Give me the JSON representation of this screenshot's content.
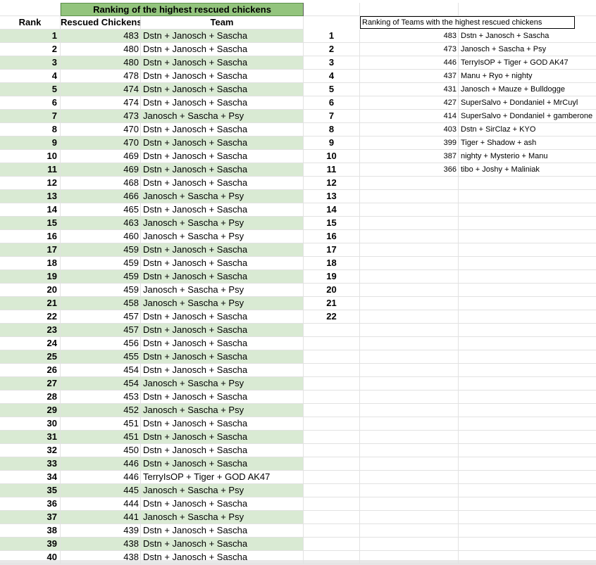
{
  "left_table": {
    "title": "Ranking of the highest rescued chickens",
    "headers": [
      "Rank",
      "Rescued Chickens",
      "Team"
    ],
    "rows": [
      {
        "rank": "1",
        "chickens": "483",
        "team": "Dstn + Janosch + Sascha",
        "green": true
      },
      {
        "rank": "2",
        "chickens": "480",
        "team": "Dstn + Janosch + Sascha",
        "green": false
      },
      {
        "rank": "3",
        "chickens": "480",
        "team": "Dstn + Janosch + Sascha",
        "green": true
      },
      {
        "rank": "4",
        "chickens": "478",
        "team": "Dstn + Janosch + Sascha",
        "green": false
      },
      {
        "rank": "5",
        "chickens": "474",
        "team": "Dstn + Janosch + Sascha",
        "green": true
      },
      {
        "rank": "6",
        "chickens": "474",
        "team": "Dstn + Janosch + Sascha",
        "green": false
      },
      {
        "rank": "7",
        "chickens": "473",
        "team": "Janosch + Sascha + Psy",
        "green": true
      },
      {
        "rank": "8",
        "chickens": "470",
        "team": "Dstn + Janosch + Sascha",
        "green": false
      },
      {
        "rank": "9",
        "chickens": "470",
        "team": "Dstn + Janosch + Sascha",
        "green": true
      },
      {
        "rank": "10",
        "chickens": "469",
        "team": "Dstn + Janosch + Sascha",
        "green": false
      },
      {
        "rank": "11",
        "chickens": "469",
        "team": "Dstn + Janosch + Sascha",
        "green": true
      },
      {
        "rank": "12",
        "chickens": "468",
        "team": "Dstn + Janosch + Sascha",
        "green": false
      },
      {
        "rank": "13",
        "chickens": "466",
        "team": "Janosch + Sascha + Psy",
        "green": true
      },
      {
        "rank": "14",
        "chickens": "465",
        "team": "Dstn + Janosch + Sascha",
        "green": false
      },
      {
        "rank": "15",
        "chickens": "463",
        "team": "Janosch + Sascha + Psy",
        "green": true
      },
      {
        "rank": "16",
        "chickens": "460",
        "team": "Janosch + Sascha + Psy",
        "green": false
      },
      {
        "rank": "17",
        "chickens": "459",
        "team": "Dstn + Janosch + Sascha",
        "green": true
      },
      {
        "rank": "18",
        "chickens": "459",
        "team": "Dstn + Janosch + Sascha",
        "green": false
      },
      {
        "rank": "19",
        "chickens": "459",
        "team": "Dstn + Janosch + Sascha",
        "green": true
      },
      {
        "rank": "20",
        "chickens": "459",
        "team": "Janosch + Sascha + Psy",
        "green": false
      },
      {
        "rank": "21",
        "chickens": "458",
        "team": "Janosch + Sascha + Psy",
        "green": true
      },
      {
        "rank": "22",
        "chickens": "457",
        "team": "Dstn + Janosch + Sascha",
        "green": false
      },
      {
        "rank": "23",
        "chickens": "457",
        "team": "Dstn + Janosch + Sascha",
        "green": true
      },
      {
        "rank": "24",
        "chickens": "456",
        "team": "Dstn + Janosch + Sascha",
        "green": false
      },
      {
        "rank": "25",
        "chickens": "455",
        "team": "Dstn + Janosch + Sascha",
        "green": true
      },
      {
        "rank": "26",
        "chickens": "454",
        "team": "Dstn + Janosch + Sascha",
        "green": false
      },
      {
        "rank": "27",
        "chickens": "454",
        "team": "Janosch + Sascha + Psy",
        "green": true
      },
      {
        "rank": "28",
        "chickens": "453",
        "team": "Dstn + Janosch + Sascha",
        "green": false
      },
      {
        "rank": "29",
        "chickens": "452",
        "team": "Janosch + Sascha + Psy",
        "green": true
      },
      {
        "rank": "30",
        "chickens": "451",
        "team": "Dstn + Janosch + Sascha",
        "green": false
      },
      {
        "rank": "31",
        "chickens": "451",
        "team": "Dstn + Janosch + Sascha",
        "green": true
      },
      {
        "rank": "32",
        "chickens": "450",
        "team": "Dstn + Janosch + Sascha",
        "green": false
      },
      {
        "rank": "33",
        "chickens": "446",
        "team": "Dstn + Janosch + Sascha",
        "green": true
      },
      {
        "rank": "34",
        "chickens": "446",
        "team": "TerryIsOP + Tiger + GOD AK47",
        "green": false
      },
      {
        "rank": "35",
        "chickens": "445",
        "team": "Janosch + Sascha + Psy",
        "green": true
      },
      {
        "rank": "36",
        "chickens": "444",
        "team": "Dstn + Janosch + Sascha",
        "green": false
      },
      {
        "rank": "37",
        "chickens": "441",
        "team": "Janosch + Sascha + Psy",
        "green": true
      },
      {
        "rank": "38",
        "chickens": "439",
        "team": "Dstn + Janosch + Sascha",
        "green": false
      },
      {
        "rank": "39",
        "chickens": "438",
        "team": "Dstn + Janosch + Sascha",
        "green": true
      },
      {
        "rank": "40",
        "chickens": "438",
        "team": "Dstn + Janosch + Sascha",
        "green": false
      }
    ]
  },
  "right_table": {
    "title": "Ranking of Teams with the highest rescued chickens",
    "rows": [
      {
        "rank": "1",
        "chickens": "483",
        "team": "Dstn + Janosch + Sascha"
      },
      {
        "rank": "2",
        "chickens": "473",
        "team": "Janosch + Sascha + Psy"
      },
      {
        "rank": "3",
        "chickens": "446",
        "team": "TerryIsOP + Tiger + GOD AK47"
      },
      {
        "rank": "4",
        "chickens": "437",
        "team": "Manu + Ryo + nighty"
      },
      {
        "rank": "5",
        "chickens": "431",
        "team": "Janosch + Mauze + Bulldogge"
      },
      {
        "rank": "6",
        "chickens": "427",
        "team": "SuperSalvo + Dondaniel + MrCuyl"
      },
      {
        "rank": "7",
        "chickens": "414",
        "team": "SuperSalvo + Dondaniel + gamberone"
      },
      {
        "rank": "8",
        "chickens": "403",
        "team": "Dstn + SirClaz + KYO"
      },
      {
        "rank": "9",
        "chickens": "399",
        "team": "Tiger + Shadow + ash"
      },
      {
        "rank": "10",
        "chickens": "387",
        "team": "nighty + Mysterio + Manu"
      },
      {
        "rank": "11",
        "chickens": "366",
        "team": "tibo + Joshy + Maliniak"
      },
      {
        "rank": "12",
        "chickens": "",
        "team": ""
      },
      {
        "rank": "13",
        "chickens": "",
        "team": ""
      },
      {
        "rank": "14",
        "chickens": "",
        "team": ""
      },
      {
        "rank": "15",
        "chickens": "",
        "team": ""
      },
      {
        "rank": "16",
        "chickens": "",
        "team": ""
      },
      {
        "rank": "17",
        "chickens": "",
        "team": ""
      },
      {
        "rank": "18",
        "chickens": "",
        "team": ""
      },
      {
        "rank": "19",
        "chickens": "",
        "team": ""
      },
      {
        "rank": "20",
        "chickens": "",
        "team": ""
      },
      {
        "rank": "21",
        "chickens": "",
        "team": ""
      },
      {
        "rank": "22",
        "chickens": "",
        "team": ""
      }
    ]
  },
  "colors": {
    "title_fill": "#93c47d",
    "band_fill": "#d9ead3",
    "gridline": "#e2e2e2"
  }
}
